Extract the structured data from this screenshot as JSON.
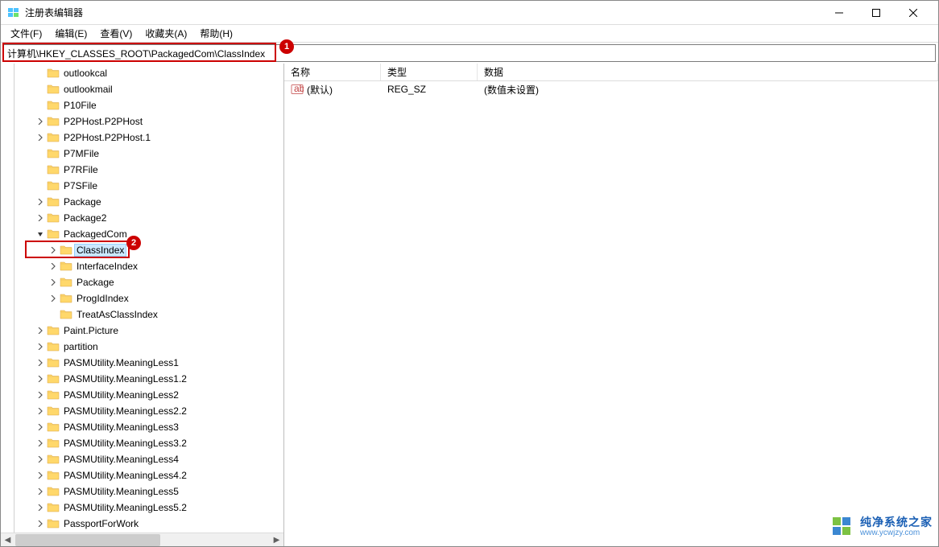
{
  "window": {
    "title": "注册表编辑器"
  },
  "menu": {
    "file": "文件(F)",
    "edit": "编辑(E)",
    "view": "查看(V)",
    "favorites": "收藏夹(A)",
    "help": "帮助(H)"
  },
  "address": {
    "path": "计算机\\HKEY_CLASSES_ROOT\\PackagedCom\\ClassIndex"
  },
  "callouts": {
    "one": "1",
    "two": "2"
  },
  "tree": {
    "items": [
      {
        "indent": 2,
        "expander": "",
        "label": "outlookcal"
      },
      {
        "indent": 2,
        "expander": "",
        "label": "outlookmail"
      },
      {
        "indent": 2,
        "expander": "",
        "label": "P10File"
      },
      {
        "indent": 2,
        "expander": ">",
        "label": "P2PHost.P2PHost"
      },
      {
        "indent": 2,
        "expander": ">",
        "label": "P2PHost.P2PHost.1"
      },
      {
        "indent": 2,
        "expander": "",
        "label": "P7MFile"
      },
      {
        "indent": 2,
        "expander": "",
        "label": "P7RFile"
      },
      {
        "indent": 2,
        "expander": "",
        "label": "P7SFile"
      },
      {
        "indent": 2,
        "expander": ">",
        "label": "Package"
      },
      {
        "indent": 2,
        "expander": ">",
        "label": "Package2"
      },
      {
        "indent": 2,
        "expander": "v",
        "label": "PackagedCom"
      },
      {
        "indent": 3,
        "expander": ">",
        "label": "ClassIndex",
        "selected": true
      },
      {
        "indent": 3,
        "expander": ">",
        "label": "InterfaceIndex"
      },
      {
        "indent": 3,
        "expander": ">",
        "label": "Package"
      },
      {
        "indent": 3,
        "expander": ">",
        "label": "ProgIdIndex"
      },
      {
        "indent": 3,
        "expander": "",
        "label": "TreatAsClassIndex"
      },
      {
        "indent": 2,
        "expander": ">",
        "label": "Paint.Picture"
      },
      {
        "indent": 2,
        "expander": ">",
        "label": "partition"
      },
      {
        "indent": 2,
        "expander": ">",
        "label": "PASMUtility.MeaningLess1"
      },
      {
        "indent": 2,
        "expander": ">",
        "label": "PASMUtility.MeaningLess1.2"
      },
      {
        "indent": 2,
        "expander": ">",
        "label": "PASMUtility.MeaningLess2"
      },
      {
        "indent": 2,
        "expander": ">",
        "label": "PASMUtility.MeaningLess2.2"
      },
      {
        "indent": 2,
        "expander": ">",
        "label": "PASMUtility.MeaningLess3"
      },
      {
        "indent": 2,
        "expander": ">",
        "label": "PASMUtility.MeaningLess3.2"
      },
      {
        "indent": 2,
        "expander": ">",
        "label": "PASMUtility.MeaningLess4"
      },
      {
        "indent": 2,
        "expander": ">",
        "label": "PASMUtility.MeaningLess4.2"
      },
      {
        "indent": 2,
        "expander": ">",
        "label": "PASMUtility.MeaningLess5"
      },
      {
        "indent": 2,
        "expander": ">",
        "label": "PASMUtility.MeaningLess5.2"
      },
      {
        "indent": 2,
        "expander": ">",
        "label": "PassportForWork"
      }
    ]
  },
  "list": {
    "columns": {
      "name": "名称",
      "type": "类型",
      "data": "数据"
    },
    "rows": [
      {
        "name": "(默认)",
        "type": "REG_SZ",
        "data": "(数值未设置)"
      }
    ]
  },
  "watermark": {
    "line1": "纯净系统之家",
    "line2": "www.ycwjzy.com"
  }
}
